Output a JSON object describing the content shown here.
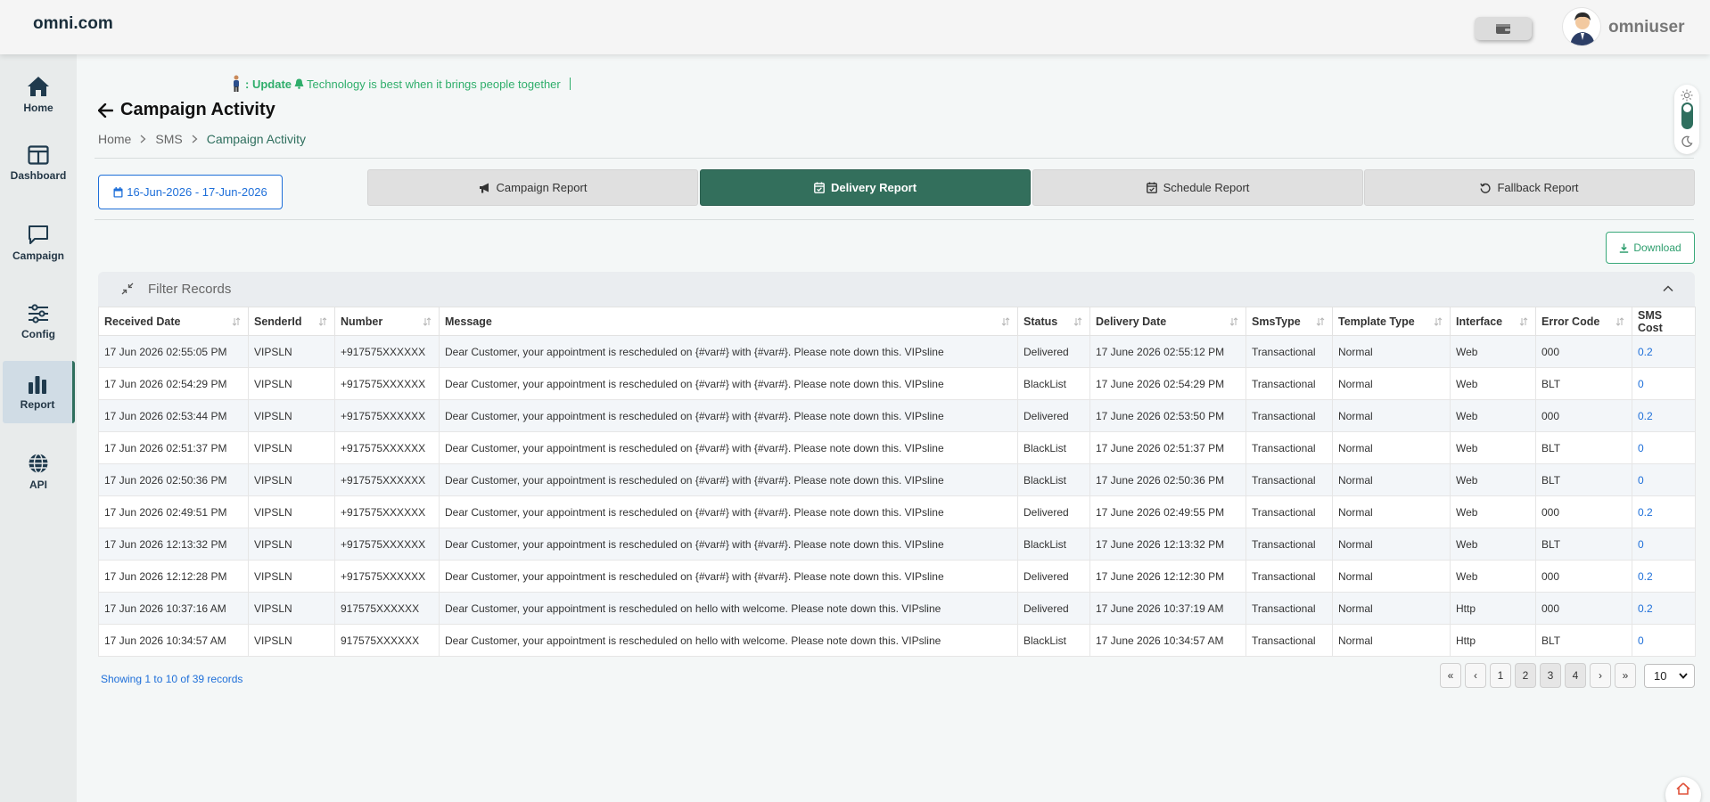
{
  "header": {
    "brand": "omni.com",
    "username": "omniuser"
  },
  "sidebar": {
    "items": [
      {
        "label": "Home",
        "icon": "home-icon"
      },
      {
        "label": "Dashboard",
        "icon": "dashboard-icon"
      },
      {
        "label": "Campaign",
        "icon": "chat-icon"
      },
      {
        "label": "Config",
        "icon": "sliders-icon"
      },
      {
        "label": "Report",
        "icon": "bar-chart-icon",
        "active": true
      },
      {
        "label": "API",
        "icon": "globe-icon"
      }
    ]
  },
  "ticker": {
    "prefix": ": Update",
    "text": "Technology is best when it brings people together"
  },
  "page": {
    "title": "Campaign Activity"
  },
  "breadcrumb": {
    "home": "Home",
    "sms": "SMS",
    "current": "Campaign Activity"
  },
  "date_range": "16-Jun-2026 - 17-Jun-2026",
  "tabs": [
    {
      "label": "Campaign Report",
      "icon": "megaphone-icon"
    },
    {
      "label": "Delivery Report",
      "icon": "calendar-check-icon",
      "active": true
    },
    {
      "label": "Schedule Report",
      "icon": "calendar-check-icon"
    },
    {
      "label": "Fallback Report",
      "icon": "history-icon"
    }
  ],
  "download_label": "Download",
  "filter": {
    "title": "Filter Records"
  },
  "table": {
    "columns": [
      "Received Date",
      "SenderId",
      "Number",
      "Message",
      "Status",
      "Delivery Date",
      "SmsType",
      "Template Type",
      "Interface",
      "Error Code",
      "SMS Cost"
    ],
    "rows": [
      [
        "17 Jun 2026 02:55:05 PM",
        "VIPSLN",
        "+917575XXXXXX",
        "Dear Customer, your appointment is rescheduled on {#var#} with {#var#}. Please note down this. VIPsline",
        "Delivered",
        "17 June 2026 02:55:12 PM",
        "Transactional",
        "Normal",
        "Web",
        "000",
        "0.2"
      ],
      [
        "17 Jun 2026 02:54:29 PM",
        "VIPSLN",
        "+917575XXXXXX",
        "Dear Customer, your appointment is rescheduled on {#var#} with {#var#}. Please note down this. VIPsline",
        "BlackList",
        "17 June 2026 02:54:29 PM",
        "Transactional",
        "Normal",
        "Web",
        "BLT",
        "0"
      ],
      [
        "17 Jun 2026 02:53:44 PM",
        "VIPSLN",
        "+917575XXXXXX",
        "Dear Customer, your appointment is rescheduled on {#var#} with {#var#}. Please note down this. VIPsline",
        "Delivered",
        "17 June 2026 02:53:50 PM",
        "Transactional",
        "Normal",
        "Web",
        "000",
        "0.2"
      ],
      [
        "17 Jun 2026 02:51:37 PM",
        "VIPSLN",
        "+917575XXXXXX",
        "Dear Customer, your appointment is rescheduled on {#var#} with {#var#}. Please note down this. VIPsline",
        "BlackList",
        "17 June 2026 02:51:37 PM",
        "Transactional",
        "Normal",
        "Web",
        "BLT",
        "0"
      ],
      [
        "17 Jun 2026 02:50:36 PM",
        "VIPSLN",
        "+917575XXXXXX",
        "Dear Customer, your appointment is rescheduled on {#var#} with {#var#}. Please note down this. VIPsline",
        "BlackList",
        "17 June 2026 02:50:36 PM",
        "Transactional",
        "Normal",
        "Web",
        "BLT",
        "0"
      ],
      [
        "17 Jun 2026 02:49:51 PM",
        "VIPSLN",
        "+917575XXXXXX",
        "Dear Customer, your appointment is rescheduled on {#var#} with {#var#}. Please note down this. VIPsline",
        "Delivered",
        "17 June 2026 02:49:55 PM",
        "Transactional",
        "Normal",
        "Web",
        "000",
        "0.2"
      ],
      [
        "17 Jun 2026 12:13:32 PM",
        "VIPSLN",
        "+917575XXXXXX",
        "Dear Customer, your appointment is rescheduled on {#var#} with {#var#}. Please note down this. VIPsline",
        "BlackList",
        "17 June 2026 12:13:32 PM",
        "Transactional",
        "Normal",
        "Web",
        "BLT",
        "0"
      ],
      [
        "17 Jun 2026 12:12:28 PM",
        "VIPSLN",
        "+917575XXXXXX",
        "Dear Customer, your appointment is rescheduled on {#var#} with {#var#}. Please note down this. VIPsline",
        "Delivered",
        "17 June 2026 12:12:30 PM",
        "Transactional",
        "Normal",
        "Web",
        "000",
        "0.2"
      ],
      [
        "17 Jun 2026 10:37:16 AM",
        "VIPSLN",
        "917575XXXXXX",
        "Dear Customer, your appointment is rescheduled on hello with welcome. Please note down this. VIPsline",
        "Delivered",
        "17 June 2026 10:37:19 AM",
        "Transactional",
        "Normal",
        "Http",
        "000",
        "0.2"
      ],
      [
        "17 Jun 2026 10:34:57 AM",
        "VIPSLN",
        "917575XXXXXX",
        "Dear Customer, your appointment is rescheduled on hello with welcome. Please note down this. VIPsline",
        "BlackList",
        "17 June 2026 10:34:57 AM",
        "Transactional",
        "Normal",
        "Http",
        "BLT",
        "0"
      ]
    ]
  },
  "pagination": {
    "showing": "Showing 1 to 10 of 39 records",
    "first": "«",
    "prev": "‹",
    "pages": [
      "1",
      "2",
      "3",
      "4"
    ],
    "next": "›",
    "last": "»",
    "per_page": "10"
  },
  "colors": {
    "accent": "#336f5c",
    "link": "#1e6fd9",
    "ticker": "#2fae6b"
  }
}
